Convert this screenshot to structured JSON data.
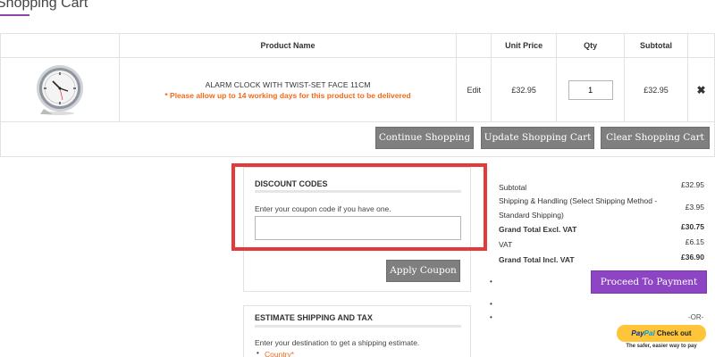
{
  "page": {
    "title": "Shopping Cart"
  },
  "cart": {
    "headers": [
      "Product Name",
      "Unit Price",
      "Qty",
      "Subtotal"
    ],
    "item": {
      "name": "ALARM CLOCK WITH TWIST-SET FACE 11CM",
      "note": "* Please allow up to 14 working days for this product to be delivered",
      "edit_label": "Edit",
      "unit_price": "£32.95",
      "qty": "1",
      "subtotal": "£32.95",
      "remove_icon": "✖"
    },
    "buttons": {
      "continue": "Continue Shopping",
      "update": "Update Shopping Cart",
      "clear": "Clear Shopping Cart"
    }
  },
  "discount": {
    "heading": "DISCOUNT CODES",
    "helper": "Enter your coupon code if you have one.",
    "input_value": "",
    "apply_label": "Apply Coupon"
  },
  "estimate": {
    "heading": "ESTIMATE SHIPPING AND TAX",
    "helper": "Enter your destination to get a shipping estimate.",
    "country_label": "Country*"
  },
  "totals": {
    "subtotal_label": "Subtotal",
    "subtotal_value": "£32.95",
    "shipping_label": "Shipping & Handling (Select Shipping Method - Standard Shipping)",
    "shipping_value": "£3.95",
    "grand_excl_label": "Grand Total Excl. VAT",
    "grand_excl_value": "£30.75",
    "vat_label": "VAT",
    "vat_value": "£6.15",
    "grand_incl_label": "Grand Total Incl. VAT",
    "grand_incl_value": "£36.90",
    "proceed_label": "Proceed To Payment",
    "or_label": "-OR-",
    "paypal_pay": "Pay",
    "paypal_pal": "Pal",
    "paypal_check": "Check out",
    "paypal_tagline": "The safer, easier way to pay"
  },
  "colors": {
    "accent_purple": "#8e45c3",
    "button_gray": "#7f7f7f",
    "highlight_red": "#e53a3a",
    "notice_orange": "#f26a1b",
    "paypal_yellow": "#ffc439"
  },
  "icons": [
    "alarm-clock-product-image",
    "remove-item-icon",
    "paypal-logo"
  ]
}
